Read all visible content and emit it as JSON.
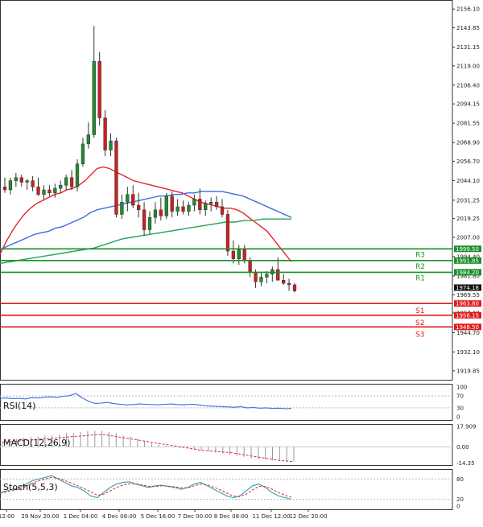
{
  "chart_data": {
    "type": "candlestick",
    "instrument_panels": {
      "main": {
        "y_ticks": [
          2156.1,
          2143.85,
          2131.15,
          2119.0,
          2106.4,
          2094.15,
          2081.55,
          2068.9,
          2056.7,
          2044.1,
          2031.25,
          2019.25,
          2007.0,
          1994.4,
          1981.8,
          1969.55,
          1957.6,
          1944.7,
          1932.1,
          1919.85
        ],
        "ylim": [
          1914,
          2162
        ],
        "current_price": "1974.18",
        "candles": [
          {
            "o": 2040,
            "h": 2046,
            "l": 2036,
            "c": 2038
          },
          {
            "o": 2038,
            "h": 2046,
            "l": 2035,
            "c": 2044
          },
          {
            "o": 2044,
            "h": 2049,
            "l": 2040,
            "c": 2046
          },
          {
            "o": 2046,
            "h": 2048,
            "l": 2040,
            "c": 2043
          },
          {
            "o": 2043,
            "h": 2045,
            "l": 2038,
            "c": 2044
          },
          {
            "o": 2044,
            "h": 2047,
            "l": 2037,
            "c": 2040
          },
          {
            "o": 2040,
            "h": 2046,
            "l": 2034,
            "c": 2035
          },
          {
            "o": 2035,
            "h": 2041,
            "l": 2032,
            "c": 2038
          },
          {
            "o": 2038,
            "h": 2041,
            "l": 2034,
            "c": 2036
          },
          {
            "o": 2036,
            "h": 2042,
            "l": 2033,
            "c": 2039
          },
          {
            "o": 2039,
            "h": 2044,
            "l": 2036,
            "c": 2041
          },
          {
            "o": 2041,
            "h": 2048,
            "l": 2038,
            "c": 2046
          },
          {
            "o": 2046,
            "h": 2051,
            "l": 2038,
            "c": 2040
          },
          {
            "o": 2040,
            "h": 2058,
            "l": 2037,
            "c": 2055
          },
          {
            "o": 2055,
            "h": 2072,
            "l": 2053,
            "c": 2068
          },
          {
            "o": 2068,
            "h": 2082,
            "l": 2065,
            "c": 2074
          },
          {
            "o": 2074,
            "h": 2145,
            "l": 2072,
            "c": 2122
          },
          {
            "o": 2122,
            "h": 2128,
            "l": 2080,
            "c": 2085
          },
          {
            "o": 2085,
            "h": 2090,
            "l": 2060,
            "c": 2064
          },
          {
            "o": 2064,
            "h": 2075,
            "l": 2060,
            "c": 2070
          },
          {
            "o": 2070,
            "h": 2072,
            "l": 2020,
            "c": 2022
          },
          {
            "o": 2022,
            "h": 2035,
            "l": 2019,
            "c": 2030
          },
          {
            "o": 2030,
            "h": 2040,
            "l": 2024,
            "c": 2035
          },
          {
            "o": 2035,
            "h": 2041,
            "l": 2026,
            "c": 2028
          },
          {
            "o": 2028,
            "h": 2036,
            "l": 2020,
            "c": 2025
          },
          {
            "o": 2025,
            "h": 2030,
            "l": 2008,
            "c": 2012
          },
          {
            "o": 2012,
            "h": 2024,
            "l": 2009,
            "c": 2020
          },
          {
            "o": 2020,
            "h": 2030,
            "l": 2016,
            "c": 2025
          },
          {
            "o": 2025,
            "h": 2033,
            "l": 2018,
            "c": 2021
          },
          {
            "o": 2021,
            "h": 2036,
            "l": 2019,
            "c": 2034
          },
          {
            "o": 2034,
            "h": 2037,
            "l": 2020,
            "c": 2024
          },
          {
            "o": 2024,
            "h": 2032,
            "l": 2021,
            "c": 2027
          },
          {
            "o": 2027,
            "h": 2031,
            "l": 2022,
            "c": 2024
          },
          {
            "o": 2024,
            "h": 2030,
            "l": 2021,
            "c": 2028
          },
          {
            "o": 2028,
            "h": 2035,
            "l": 2024,
            "c": 2032
          },
          {
            "o": 2032,
            "h": 2039,
            "l": 2022,
            "c": 2025
          },
          {
            "o": 2025,
            "h": 2031,
            "l": 2021,
            "c": 2029
          },
          {
            "o": 2029,
            "h": 2033,
            "l": 2024,
            "c": 2030
          },
          {
            "o": 2030,
            "h": 2034,
            "l": 2025,
            "c": 2027
          },
          {
            "o": 2027,
            "h": 2032,
            "l": 2020,
            "c": 2022
          },
          {
            "o": 2022,
            "h": 2025,
            "l": 1995,
            "c": 1998
          },
          {
            "o": 1998,
            "h": 2005,
            "l": 1990,
            "c": 1993
          },
          {
            "o": 1993,
            "h": 2002,
            "l": 1989,
            "c": 1999
          },
          {
            "o": 1999,
            "h": 2002,
            "l": 1990,
            "c": 1992
          },
          {
            "o": 1992,
            "h": 1994,
            "l": 1981,
            "c": 1984
          },
          {
            "o": 1984,
            "h": 1986,
            "l": 1974,
            "c": 1978
          },
          {
            "o": 1978,
            "h": 1984,
            "l": 1975,
            "c": 1981
          },
          {
            "o": 1981,
            "h": 1985,
            "l": 1977,
            "c": 1983
          },
          {
            "o": 1983,
            "h": 1988,
            "l": 1978,
            "c": 1986
          },
          {
            "o": 1986,
            "h": 1994,
            "l": 1981,
            "c": 1979
          },
          {
            "o": 1979,
            "h": 1983,
            "l": 1976,
            "c": 1977
          },
          {
            "o": 1977,
            "h": 1980,
            "l": 1972,
            "c": 1976
          },
          {
            "o": 1976,
            "h": 1977,
            "l": 1971,
            "c": 1972
          }
        ],
        "moving_averages": [
          {
            "color": "#e8232a",
            "values": [
              1996,
              2004,
              2011,
              2017,
              2022,
              2026,
              2029,
              2031,
              2033,
              2035,
              2036,
              2038,
              2039,
              2041,
              2044,
              2048,
              2052,
              2053,
              2052,
              2050,
              2048,
              2046,
              2044,
              2043,
              2042,
              2041,
              2040,
              2039,
              2038,
              2037,
              2036,
              2034,
              2032,
              2030,
              2029,
              2028,
              2027,
              2026,
              2026,
              2025,
              2023,
              2020,
              2017,
              2014,
              2011,
              2006,
              2001,
              1996,
              1991
            ]
          },
          {
            "color": "#3a6fd8",
            "values": [
              1999,
              2001,
              2003,
              2005,
              2007,
              2009,
              2010,
              2011,
              2013,
              2014,
              2016,
              2018,
              2020,
              2023,
              2025,
              2026,
              2027,
              2028,
              2029,
              2030,
              2031,
              2032,
              2033,
              2034,
              2034,
              2035,
              2035,
              2036,
              2036,
              2037,
              2037,
              2037,
              2037,
              2036,
              2035,
              2034,
              2032,
              2030,
              2028,
              2026,
              2024,
              2022,
              2020
            ]
          },
          {
            "color": "#2aa05a",
            "values": [
              1990,
              1991,
              1992,
              1993,
              1994,
              1995,
              1996,
              1997,
              1998,
              1999,
              2000,
              2002,
              2004,
              2006,
              2007,
              2008,
              2009,
              2010,
              2011,
              2012,
              2013,
              2014,
              2015,
              2016,
              2017,
              2017,
              2018,
              2018,
              2019,
              2019,
              2019,
              2019
            ]
          }
        ],
        "levels": [
          {
            "name": "R3",
            "price": "1999.50",
            "value": 1999.5,
            "color": "#1a8f2a"
          },
          {
            "name": "R2",
            "price": "1991.85",
            "value": 1991.85,
            "color": "#1a8f2a"
          },
          {
            "name": "R1",
            "price": "1984.20",
            "value": 1984.2,
            "color": "#1a8f2a"
          },
          {
            "name": "S1",
            "price": "1963.80",
            "value": 1963.8,
            "color": "#e01b1b"
          },
          {
            "name": "S2",
            "price": "1956.15",
            "value": 1956.15,
            "color": "#e01b1b"
          },
          {
            "name": "S3",
            "price": "1948.50",
            "value": 1948.5,
            "color": "#e01b1b"
          }
        ]
      },
      "rsi": {
        "label": "RSI(14)",
        "ticks": [
          "100",
          "70",
          "30",
          "0"
        ],
        "tick_values": [
          100,
          70,
          30,
          0
        ],
        "values": [
          62,
          63,
          61,
          62,
          60,
          64,
          63,
          66,
          67,
          65,
          69,
          71,
          78,
          63,
          52,
          45,
          46,
          48,
          44,
          42,
          40,
          41,
          43,
          42,
          41,
          40,
          42,
          43,
          41,
          40,
          42,
          41,
          38,
          36,
          35,
          34,
          33,
          32,
          34,
          30,
          31,
          29,
          30,
          28,
          29,
          27,
          28
        ]
      },
      "macd": {
        "label": "MACD(12,26,9)",
        "ticks": [
          "17.909",
          "0.00",
          "-14.35"
        ],
        "tick_values": [
          17.909,
          0,
          -14.35
        ],
        "histogram": [
          5,
          6,
          7,
          8,
          9,
          9,
          10,
          10,
          11,
          12,
          12,
          13,
          14,
          14,
          14,
          13,
          12,
          10,
          9,
          7,
          5,
          3,
          2,
          1,
          0,
          -1,
          -1,
          -2,
          -3,
          -4,
          -5,
          -6,
          -7,
          -8,
          -9,
          -10,
          -11,
          -11,
          -12,
          -12,
          -13,
          -13
        ],
        "signal": [
          4,
          4.5,
          5,
          5.5,
          6,
          6.5,
          7,
          7.5,
          8,
          8.5,
          9,
          9.5,
          10,
          10.5,
          11,
          10,
          9,
          8,
          7,
          6,
          5,
          4,
          3,
          2,
          1,
          0,
          -1,
          -2,
          -3,
          -3.5,
          -4,
          -4.5,
          -5,
          -6,
          -7,
          -8,
          -9,
          -10,
          -11,
          -12,
          -12.5,
          -13
        ]
      },
      "stoch": {
        "label": "Stoch(5,5,3)",
        "ticks": [
          "80",
          "20",
          "0"
        ],
        "tick_values": [
          80,
          20,
          0
        ],
        "k": [
          40,
          45,
          50,
          55,
          65,
          75,
          80,
          85,
          90,
          80,
          70,
          60,
          55,
          45,
          30,
          25,
          40,
          55,
          65,
          70,
          72,
          65,
          60,
          55,
          60,
          62,
          58,
          55,
          50,
          55,
          65,
          70,
          60,
          50,
          40,
          30,
          25,
          30,
          45,
          60,
          65,
          55,
          40,
          30,
          25,
          20
        ],
        "d": [
          38,
          42,
          46,
          50,
          58,
          68,
          75,
          80,
          85,
          82,
          76,
          68,
          60,
          52,
          42,
          32,
          35,
          45,
          55,
          62,
          66,
          66,
          62,
          58,
          58,
          60,
          59,
          57,
          54,
          54,
          60,
          65,
          63,
          56,
          48,
          38,
          30,
          28,
          35,
          48,
          58,
          58,
          50,
          40,
          32,
          26
        ]
      }
    },
    "x_labels": [
      "12:00",
      "29 Nov 20:00",
      "1 Dec 04:00",
      "4 Dec 08:00",
      "5 Dec 16:00",
      "7 Dec 00:00",
      "8 Dec 08:00",
      "11 Dec 12:00",
      "12 Dec 20:00"
    ]
  }
}
